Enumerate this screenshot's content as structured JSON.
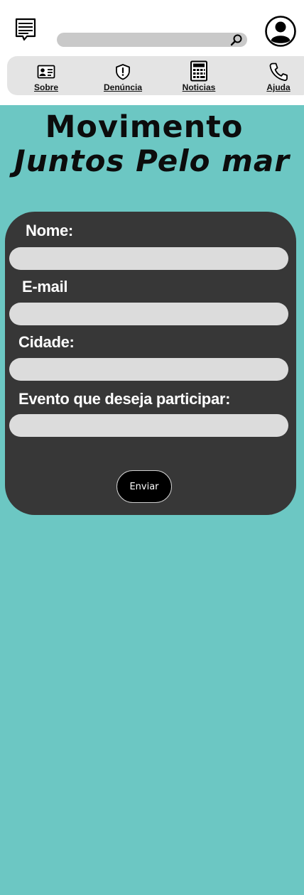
{
  "header": {
    "menu_icon": "chat-list-icon",
    "search": {
      "placeholder": "",
      "value": "",
      "icon": "search-icon"
    },
    "profile_icon": "user-avatar-icon"
  },
  "nav": {
    "items": [
      {
        "label": "Sobre",
        "icon": "id-card-icon"
      },
      {
        "label": "Denúncia",
        "icon": "shield-alert-icon"
      },
      {
        "label": "Noticias",
        "icon": "calculator-icon"
      },
      {
        "label": "Ajuda",
        "icon": "phone-icon"
      }
    ]
  },
  "hero": {
    "title_line1": "Movimento",
    "title_line2": "Juntos Pelo mar"
  },
  "form": {
    "fields": [
      {
        "label": "Nome:",
        "value": ""
      },
      {
        "label": "E-mail",
        "value": ""
      },
      {
        "label": "Cidade:",
        "value": ""
      },
      {
        "label": "Evento que deseja participar:",
        "value": ""
      }
    ],
    "submit_label": "Enviar"
  },
  "colors": {
    "background": "#6cc7c3",
    "header": "#ffffff",
    "nav": "#e4e4e4",
    "form_card": "#373737",
    "input": "#dcdcdc",
    "button": "#000000"
  }
}
